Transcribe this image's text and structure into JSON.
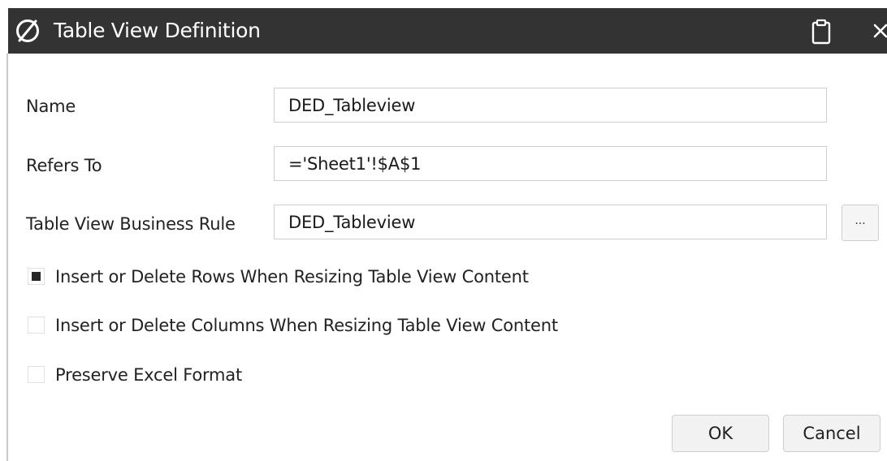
{
  "window": {
    "title": "Table View Definition",
    "titlebar_color": "#333333",
    "icons": [
      "oracle-logo-icon",
      "clipboard-icon",
      "close-icon"
    ]
  },
  "form": {
    "name_label": "Name",
    "name_value": "DED_Tableview",
    "refers_to_label": "Refers To",
    "refers_to_value": "='Sheet1'!$A$1",
    "business_rule_label": "Table View Business Rule",
    "business_rule_value": "DED_Tableview",
    "browse_label": "..."
  },
  "options": [
    {
      "label": "Insert or Delete Rows When Resizing Table View Content",
      "checked": true
    },
    {
      "label": "Insert or Delete Columns When Resizing Table View Content",
      "checked": false
    },
    {
      "label": "Preserve Excel Format",
      "checked": false
    }
  ],
  "buttons": {
    "ok_label": "OK",
    "cancel_label": "Cancel"
  }
}
